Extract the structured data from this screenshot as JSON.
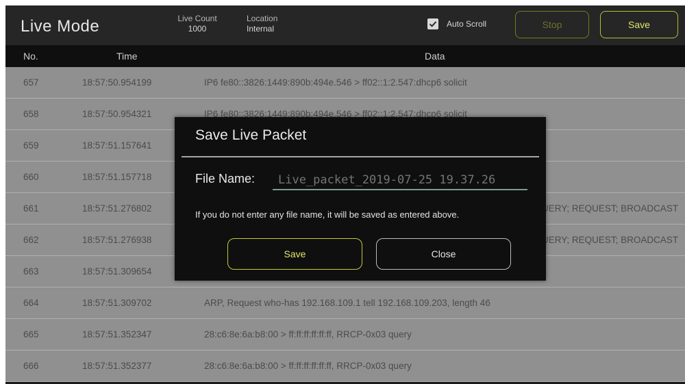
{
  "header": {
    "title": "Live Mode",
    "live_count_label": "Live Count",
    "live_count_value": "1000",
    "location_label": "Location",
    "location_value": "Internal",
    "auto_scroll_label": "Auto Scroll",
    "auto_scroll_checked": true,
    "stop_label": "Stop",
    "save_label": "Save"
  },
  "table": {
    "columns": [
      "No.",
      "Time",
      "Data"
    ],
    "rows": [
      {
        "no": "657",
        "time": "18:57:50.954199",
        "data": "IP6 fe80::3826:1449:890b:494e.546 > ff02::1:2.547:dhcp6 solicit"
      },
      {
        "no": "658",
        "time": "18:57:50.954321",
        "data": "IP6 fe80::3826:1449:890b:494e.546 > ff02::1:2.547:dhcp6 solicit"
      },
      {
        "no": "659",
        "time": "18:57:51.157641",
        "data": ""
      },
      {
        "no": "660",
        "time": "18:57:51.157718",
        "data": ""
      },
      {
        "no": "661",
        "time": "18:57:51.276802",
        "data": "UERY; REQUEST; BROADCAST"
      },
      {
        "no": "662",
        "time": "18:57:51.276938",
        "data": "UERY; REQUEST; BROADCAST"
      },
      {
        "no": "663",
        "time": "18:57:51.309654",
        "data": ""
      },
      {
        "no": "664",
        "time": "18:57:51.309702",
        "data": "ARP, Request who-has 192.168.109.1 tell 192.168.109.203, length 46"
      },
      {
        "no": "665",
        "time": "18:57:51.352347",
        "data": "28:c6:8e:6a:b8:00 > ff:ff:ff:ff:ff:ff, RRCP-0x03 query"
      },
      {
        "no": "666",
        "time": "18:57:51.352377",
        "data": "28:c6:8e:6a:b8:00 > ff:ff:ff:ff:ff:ff, RRCP-0x03 query"
      }
    ]
  },
  "modal": {
    "title": "Save Live Packet",
    "file_name_label": "File Name:",
    "file_name_placeholder": "Live_packet_2019-07-25 19.37.26",
    "hint": "If you do not enter any file name, it will be saved as entered above.",
    "save_label": "Save",
    "close_label": "Close"
  },
  "colors": {
    "accent_yellow": "#e1e66b",
    "row_bg": "#909090",
    "header_bg": "#262626"
  }
}
